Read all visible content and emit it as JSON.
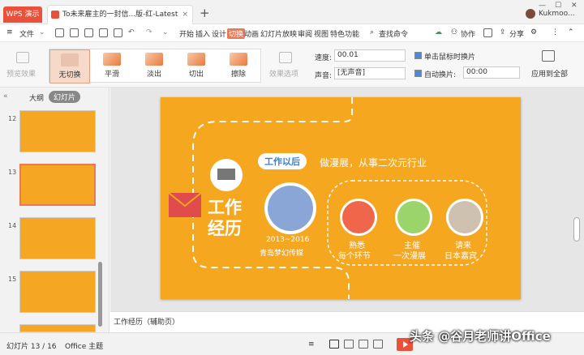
{
  "window": {
    "app_tab": "WPS 演示",
    "doc_tab": "To未来雇主的一封信...版-红-Latest",
    "user": "Kukmoo..."
  },
  "menu": {
    "file": "文件",
    "items": [
      "开始",
      "插入",
      "设计",
      "切换",
      "动画",
      "幻灯片放映",
      "审阅",
      "视图",
      "特色功能"
    ],
    "active": "切换",
    "search": "查找命令",
    "collab": "协作",
    "share": "分享"
  },
  "ribbon": {
    "preview_label": "预览效果",
    "transitions": [
      {
        "label": "无切换",
        "selected": true
      },
      {
        "label": "平滑"
      },
      {
        "label": "淡出"
      },
      {
        "label": "切出"
      },
      {
        "label": "擦除"
      }
    ],
    "effect_options_label": "效果选项",
    "speed_label": "速度:",
    "speed_value": "00.01",
    "sound_label": "声音:",
    "sound_value": "[无声音]",
    "on_click_label": "单击鼠标时换片",
    "auto_label": "自动换片:",
    "auto_value": "00:00",
    "apply_all_label": "应用到全部"
  },
  "sidebar": {
    "tabs": {
      "outline": "大纲",
      "slides": "幻灯片"
    },
    "slides": [
      {
        "num": "12"
      },
      {
        "num": "13"
      },
      {
        "num": "14"
      },
      {
        "num": "15"
      }
    ]
  },
  "slide": {
    "title_line1": "工作",
    "title_line2": "经历",
    "badge": "工作以后",
    "headline": "做漫展，从事二次元行业",
    "years": "2013~2016",
    "company": "青岛梦幻传媒",
    "items": [
      {
        "line1": "熟悉",
        "line2": "每个环节"
      },
      {
        "line1": "主催",
        "line2": "一次漫展"
      },
      {
        "line1": "请来",
        "line2": "日本嘉宾"
      }
    ]
  },
  "notes": {
    "text": "工作经历（辅助页）"
  },
  "status": {
    "slide_counter": "幻灯片 13 / 16",
    "theme": "Office 主题"
  },
  "watermark": "头条 @谷月老师讲Office"
}
